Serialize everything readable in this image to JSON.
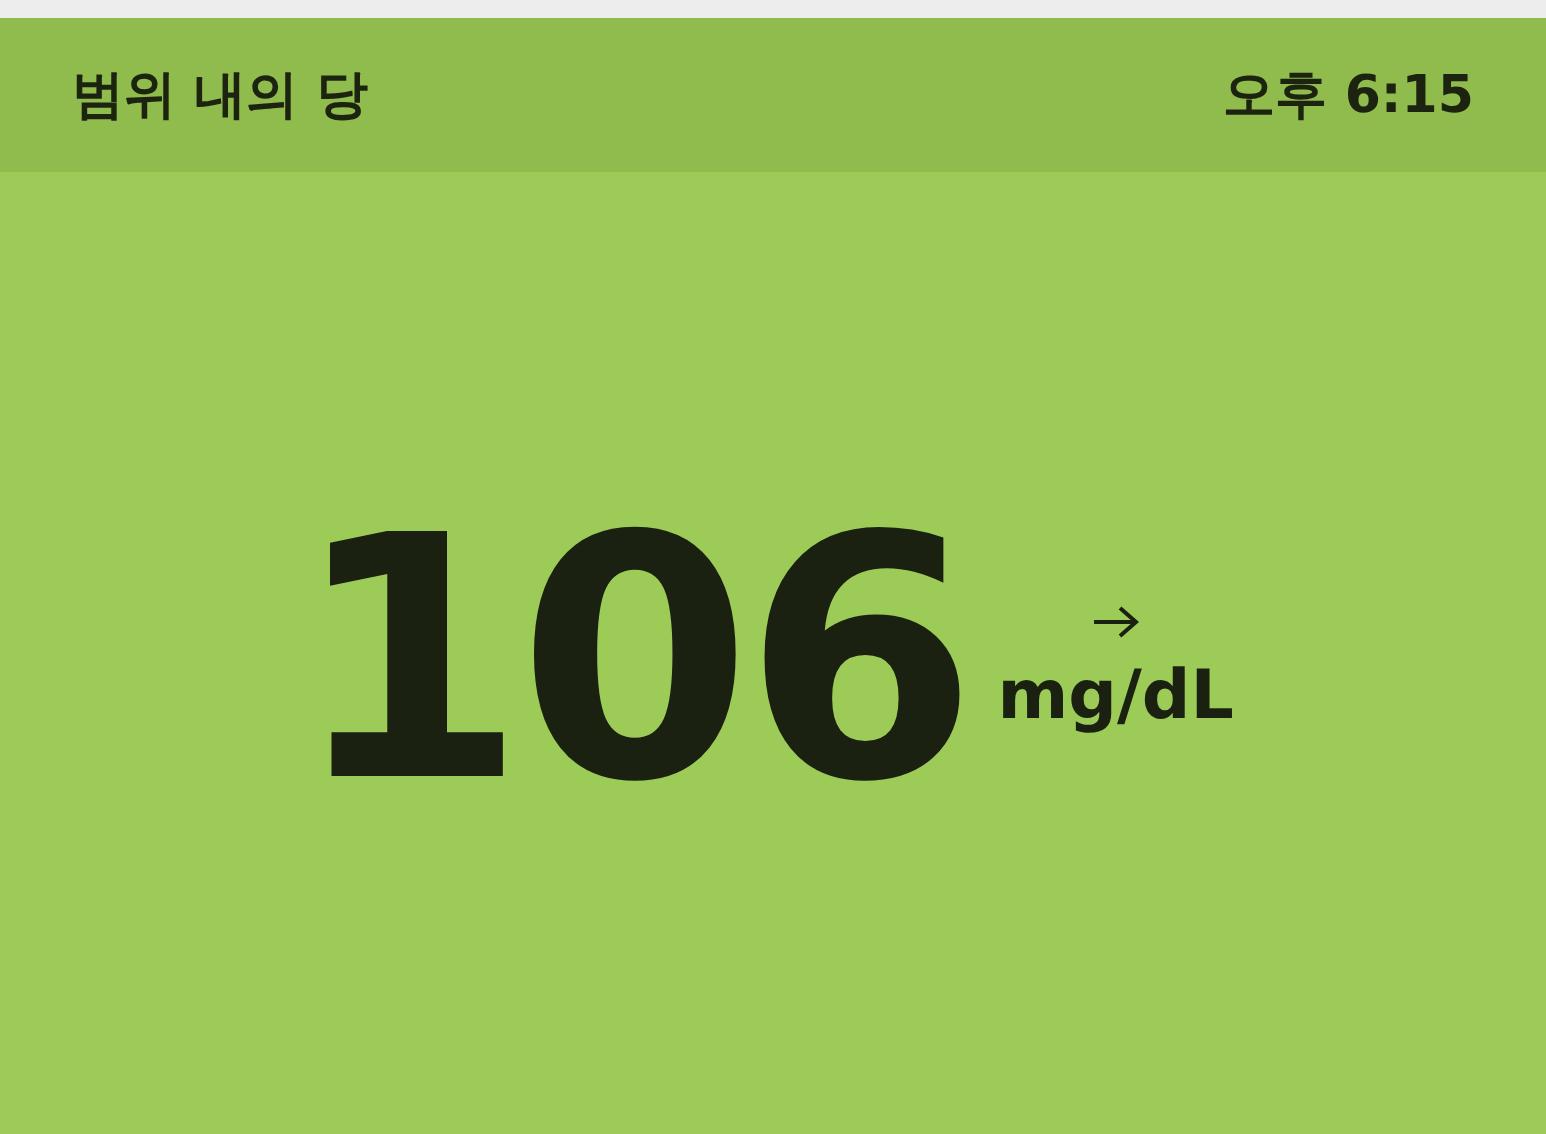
{
  "header": {
    "title": "범위 내의 당",
    "time": "오후 6:15"
  },
  "reading": {
    "value": "106",
    "unit": "mg/dL"
  }
}
